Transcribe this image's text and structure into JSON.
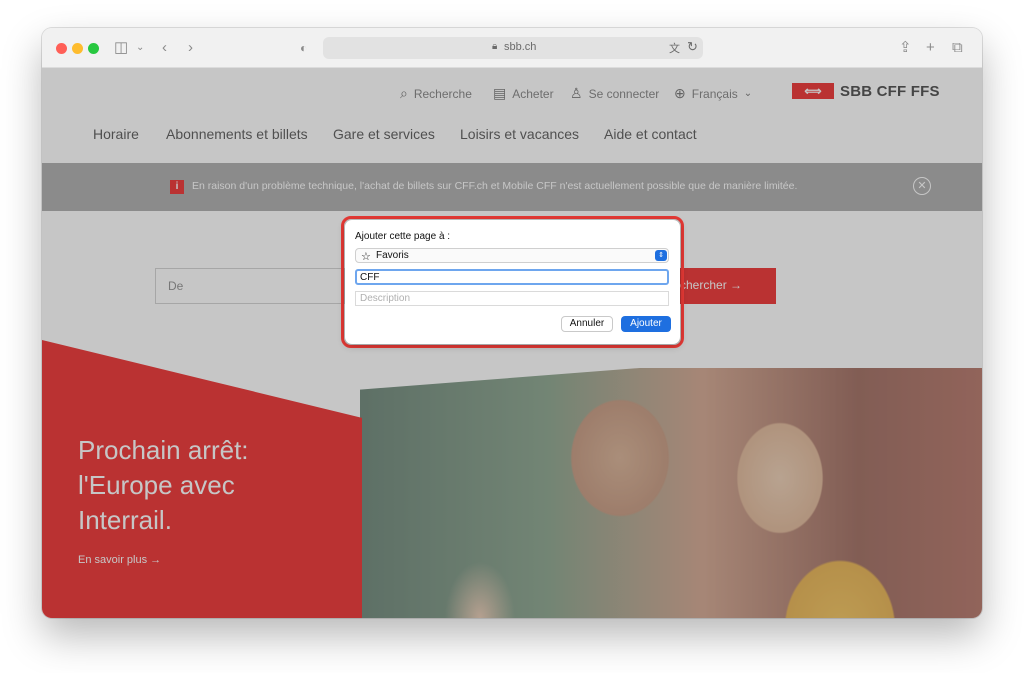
{
  "browser": {
    "url": "sbb.ch",
    "icons": {
      "sidebar": "sidebar-icon",
      "back": "chevron-left-icon",
      "forward": "chevron-right-icon",
      "privacy": "shield-icon",
      "share": "share-icon",
      "new_tab": "plus-icon",
      "tabs": "tab-overview-icon",
      "lock": "lock-icon",
      "translate": "translate-icon",
      "reload": "reload-icon"
    }
  },
  "site": {
    "utility": {
      "search_label": "Recherche",
      "buy_label": "Acheter",
      "login_label": "Se connecter",
      "language_label": "Français"
    },
    "logo_text": "SBB CFF FFS",
    "nav": [
      "Horaire",
      "Abonnements et billets",
      "Gare et services",
      "Loisirs et vacances",
      "Aide et contact"
    ],
    "banner_message": "En raison d'un problème technique, l'achat de billets sur CFF.ch et Mobile CFF n'est actuellement possible que de manière limitée.",
    "search_from_placeholder": "De",
    "search_button_label": "chercher →",
    "hero_title": "Prochain arrêt: l'Europe avec Interrail.",
    "hero_link_label": "En savoir plus →"
  },
  "dialog": {
    "heading": "Ajouter cette page à :",
    "folder_value": "Favoris",
    "title_value": "CFF",
    "description_placeholder": "Description",
    "cancel_label": "Annuler",
    "add_label": "Ajouter"
  },
  "colors": {
    "brand_red": "#eb0000",
    "accent_blue": "#1e6fe0",
    "highlight_ring": "#e53935"
  }
}
